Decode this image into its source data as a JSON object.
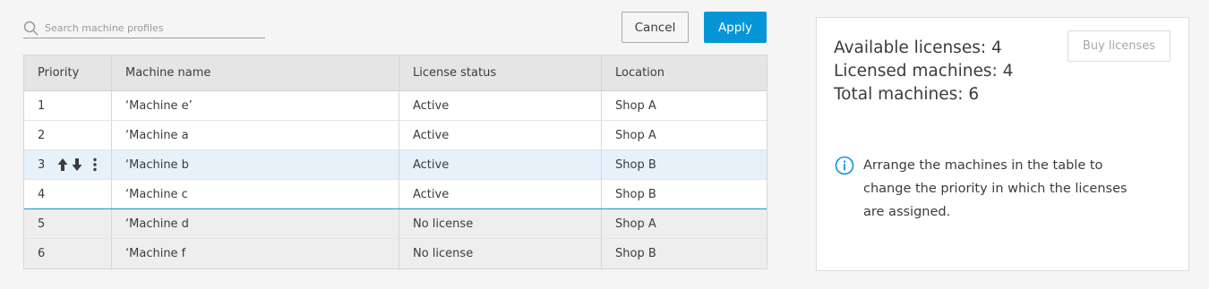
{
  "search": {
    "placeholder": "Search machine profiles",
    "value": ""
  },
  "actions": {
    "cancel_label": "Cancel",
    "apply_label": "Apply"
  },
  "colors": {
    "accent": "#0696d7",
    "header_bg": "#e5e5e5",
    "selected_row_bg": "#e6f1fa",
    "unlicensed_row_bg": "#eeeeee"
  },
  "table": {
    "columns": [
      "Priority",
      "Machine name",
      "License status",
      "Location"
    ],
    "rows": [
      {
        "priority": "1",
        "name": "‘Machine e’",
        "status": "Active",
        "location": "Shop A"
      },
      {
        "priority": "2",
        "name": "‘Machine a",
        "status": "Active",
        "location": "Shop A"
      },
      {
        "priority": "3",
        "name": "‘Machine b",
        "status": "Active",
        "location": "Shop B"
      },
      {
        "priority": "4",
        "name": "‘Machine c",
        "status": "Active",
        "location": "Shop B"
      },
      {
        "priority": "5",
        "name": "‘Machine d",
        "status": "No license",
        "location": "Shop A"
      },
      {
        "priority": "6",
        "name": "‘Machine f",
        "status": "No license",
        "location": "Shop B"
      }
    ],
    "row_tool_icons": [
      "arrow-up-icon",
      "arrow-down-icon",
      "kebab-menu-icon"
    ]
  },
  "panel": {
    "available": "Available licenses: 4",
    "licensed": "Licensed machines: 4",
    "total": "Total machines: 6",
    "buy_label": "Buy licenses",
    "info_icon": "info-icon",
    "info_text": "Arrange the machines in the table to change the priority in which the licenses are assigned."
  }
}
